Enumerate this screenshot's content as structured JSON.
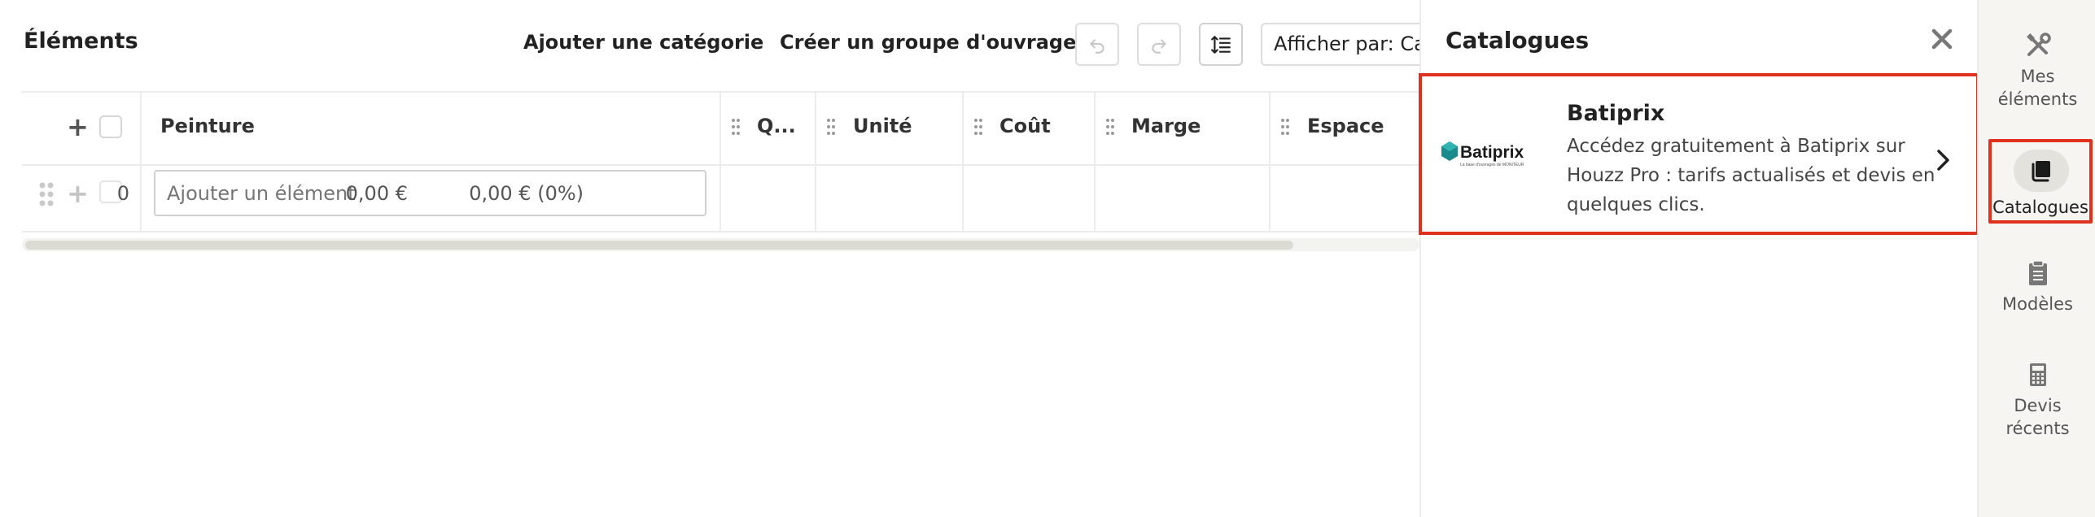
{
  "toolbar": {
    "title": "Éléments",
    "add_category": "Ajouter une catégorie",
    "create_group": "Créer un groupe d'ouvrages",
    "view_by": "Afficher par: Ca"
  },
  "table": {
    "columns": [
      "Peinture",
      "Q...",
      "Unité",
      "Coût",
      "Marge",
      "Espace"
    ],
    "row": {
      "input_placeholder": "Ajouter un élément",
      "quantity": "0",
      "unit": "",
      "cost": "0,00 €",
      "margin": "0,00 € (0%)"
    }
  },
  "panel": {
    "title": "Catalogues",
    "catalog": {
      "name": "Batiprix",
      "description": "Accédez gratuitement à Batiprix sur Houzz Pro : tarifs actualisés et devis en quelques clics.",
      "logo_text": "Batiprix",
      "logo_tagline": "La base d'ouvrages de MONITEUR"
    }
  },
  "rail": {
    "items": [
      {
        "label": "Mes éléments",
        "icon": "tools-icon"
      },
      {
        "label": "Catalogues",
        "icon": "book-icon"
      },
      {
        "label": "Modèles",
        "icon": "clipboard-icon"
      },
      {
        "label": "Devis récents",
        "icon": "calculator-icon"
      }
    ]
  },
  "colors": {
    "highlight": "#e0301e",
    "rail_bg": "#f6f5f2",
    "logo_teal": "#1b8a8c"
  }
}
